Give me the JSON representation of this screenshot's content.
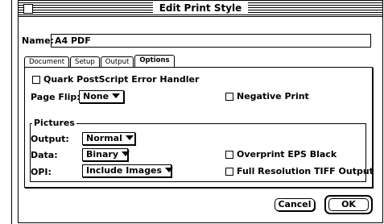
{
  "window": {
    "title": "Edit Print Style"
  },
  "name_field": {
    "label": "Name:",
    "value": "A4 PDF"
  },
  "tabs": [
    {
      "label": "Document",
      "active": false
    },
    {
      "label": "Setup",
      "active": false
    },
    {
      "label": "Output",
      "active": false
    },
    {
      "label": "Options",
      "active": true
    }
  ],
  "options": {
    "error_handler_label": "Quark PostScript Error Handler",
    "page_flip_label": "Page Flip:",
    "page_flip_value": "None",
    "negative_print_label": "Negative Print"
  },
  "pictures": {
    "group_label": "Pictures",
    "output_label": "Output:",
    "output_value": "Normal",
    "data_label": "Data:",
    "data_value": "Binary",
    "opi_label": "OPI:",
    "opi_value": "Include Images",
    "overprint_label": "Overprint EPS Black",
    "full_res_label": "Full Resolution TIFF Output"
  },
  "buttons": {
    "cancel": "Cancel",
    "ok": "OK"
  },
  "icons": [
    "close-box-icon",
    "chevron-down-icon"
  ]
}
